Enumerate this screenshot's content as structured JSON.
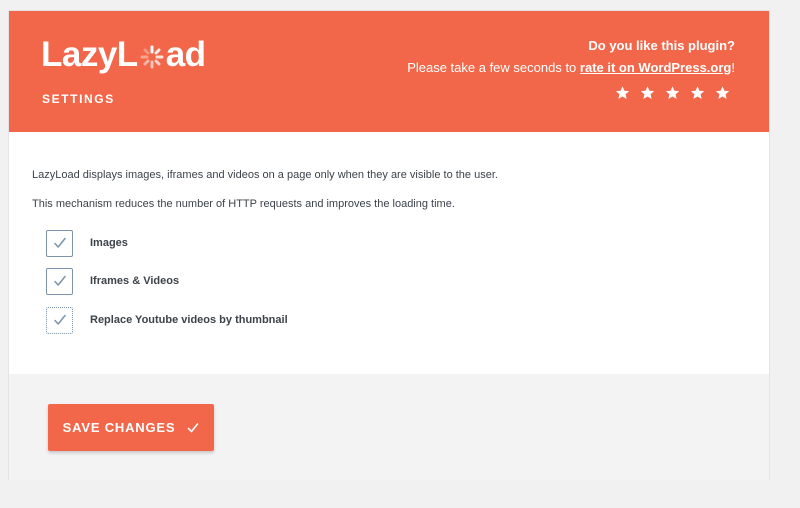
{
  "header": {
    "logo_left": "LazyL",
    "logo_right": "ad",
    "settings_label": "SETTINGS",
    "promo_title": "Do you like this plugin?",
    "promo_text_before": "Please take a few seconds to ",
    "promo_link": "rate it on WordPress.org",
    "promo_text_after": "!",
    "star_count": 5,
    "brand_color": "#f2674a"
  },
  "body": {
    "description_1": "LazyLoad displays images, iframes and videos on a page only when they are visible to the user.",
    "description_2": "This mechanism reduces the number of HTTP requests and improves the loading time.",
    "options": [
      {
        "label": "Images",
        "checked": true
      },
      {
        "label": "Iframes & Videos",
        "checked": true
      },
      {
        "label": "Replace Youtube videos by thumbnail",
        "checked": true
      }
    ]
  },
  "footer": {
    "save_label": "SAVE CHANGES",
    "save_icon": "check-icon"
  }
}
